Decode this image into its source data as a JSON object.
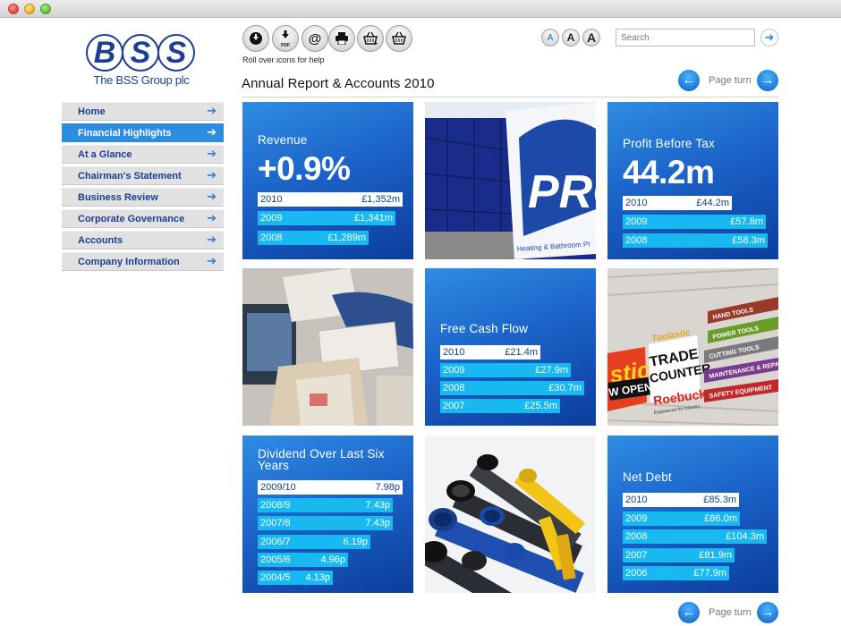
{
  "window": {
    "buttons": [
      "close",
      "minimize",
      "zoom"
    ]
  },
  "logo": {
    "letters": [
      "B",
      "S",
      "S"
    ],
    "tagline": "The BSS Group plc",
    "color": "#1c3e94"
  },
  "toolbar": {
    "icons": [
      {
        "name": "download-icon",
        "glyph": "⬇"
      },
      {
        "name": "pdf-icon",
        "glyph": "⬇",
        "sub": "PDF"
      },
      {
        "name": "email-icon",
        "glyph": "@"
      },
      {
        "name": "print-icon",
        "glyph": "⎙"
      },
      {
        "name": "add-to-basket-icon",
        "glyph": "⊞"
      },
      {
        "name": "basket-icon",
        "glyph": "⊟"
      }
    ],
    "help": "Roll over icons for help",
    "font_sizes": [
      "A",
      "A",
      "A"
    ]
  },
  "search": {
    "placeholder": "Search"
  },
  "header": {
    "title": "Annual Report & Accounts 2010",
    "page_turn": "Page turn"
  },
  "footer": {
    "page_turn": "Page turn"
  },
  "nav": {
    "items": [
      {
        "label": "Home",
        "active": false
      },
      {
        "label": "Financial Highlights",
        "active": true
      },
      {
        "label": "At a Glance",
        "active": false
      },
      {
        "label": "Chairman's Statement",
        "active": false
      },
      {
        "label": "Business Review",
        "active": false
      },
      {
        "label": "Corporate Governance",
        "active": false
      },
      {
        "label": "Accounts",
        "active": false
      },
      {
        "label": "Company Information",
        "active": false
      }
    ]
  },
  "tiles": {
    "revenue": {
      "title": "Revenue",
      "big": "+0.9%",
      "rows": [
        {
          "year": "2010",
          "value": "£1,352m"
        },
        {
          "year": "2009",
          "value": "£1,341m"
        },
        {
          "year": "2008",
          "value": "£1,289m"
        }
      ]
    },
    "profit": {
      "title": "Profit Before Tax",
      "big": "44.2m",
      "rows": [
        {
          "year": "2010",
          "value": "£44.2m"
        },
        {
          "year": "2009",
          "value": "£57.8m"
        },
        {
          "year": "2008",
          "value": "£58.3m"
        }
      ]
    },
    "cashflow": {
      "title": "Free Cash Flow",
      "rows": [
        {
          "year": "2010",
          "value": "£21.4m"
        },
        {
          "year": "2009",
          "value": "£27.9m"
        },
        {
          "year": "2008",
          "value": "£30.7m"
        },
        {
          "year": "2007",
          "value": "£25.5m"
        }
      ]
    },
    "dividend": {
      "title_line1": "Dividend Over Last Six",
      "title_line2": "Years",
      "rows": [
        {
          "year": "2009/10",
          "value": "7.98p"
        },
        {
          "year": "2008/9",
          "value": "7.43p"
        },
        {
          "year": "2007/8",
          "value": "7.43p"
        },
        {
          "year": "2006/7",
          "value": "6.19p"
        },
        {
          "year": "2005/6",
          "value": "4.96p"
        },
        {
          "year": "2004/5",
          "value": "4.13p"
        }
      ]
    },
    "netdebt": {
      "title": "Net Debt",
      "rows": [
        {
          "year": "2010",
          "value": "£85.3m"
        },
        {
          "year": "2009",
          "value": "£86.0m"
        },
        {
          "year": "2008",
          "value": "£104.3m"
        },
        {
          "year": "2007",
          "value": "£81.9m"
        },
        {
          "year": "2006",
          "value": "£77.9m"
        }
      ]
    },
    "photos": {
      "building_sign": "PRO",
      "building_sub": "Heating & Bathroom Pr",
      "signs": [
        "HAND TOOLS",
        "POWER TOOLS",
        "CUTTING TOOLS",
        "MAINTENANCE & REPAI",
        "SAFETY EQUIPMENT"
      ],
      "trade": [
        "TRADE",
        "COUNTER"
      ],
      "toolastic": "Toolastic",
      "stic": "stic",
      "now_open": "W OPEN",
      "roebuck": "Roebuck",
      "roebuck_sub": "Engineered for Industry"
    }
  },
  "colors": {
    "accent": "#2b8ce0",
    "tile_blue_dark": "#0b3d9c",
    "bar_cyan": "#17b9f0",
    "nav_text": "#1b3f8f"
  }
}
